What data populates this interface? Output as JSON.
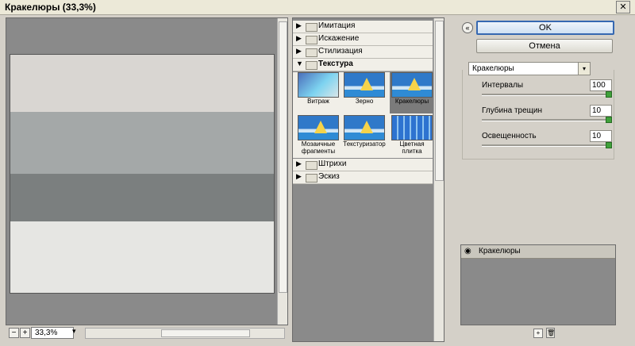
{
  "window": {
    "title": "Кракелюры (33,3%)",
    "close_glyph": "✕"
  },
  "preview": {
    "zoom_out_glyph": "−",
    "zoom_in_glyph": "+",
    "zoom_value": "33,3%",
    "dropdown_glyph": "▾"
  },
  "gallery": {
    "folders": [
      {
        "label": "Имитация",
        "open": false,
        "tri": "▶"
      },
      {
        "label": "Искажение",
        "open": false,
        "tri": "▶"
      },
      {
        "label": "Стилизация",
        "open": false,
        "tri": "▶"
      },
      {
        "label": "Текстура",
        "open": true,
        "tri": "▼"
      },
      {
        "label": "Штрихи",
        "open": false,
        "tri": "▶"
      },
      {
        "label": "Эскиз",
        "open": false,
        "tri": "▶"
      }
    ],
    "thumbs": [
      {
        "label": "Витраж",
        "selected": false
      },
      {
        "label": "Зерно",
        "selected": false
      },
      {
        "label": "Кракелюры",
        "selected": true
      },
      {
        "label": "Мозаичные фрагменты",
        "selected": false
      },
      {
        "label": "Текстуризатор",
        "selected": false
      },
      {
        "label": "Цветная плитка",
        "selected": false
      }
    ]
  },
  "controls": {
    "collapse_glyph": "«",
    "ok_label": "OK",
    "cancel_label": "Отмена",
    "filter_selected": "Кракелюры",
    "filter_arrow": "▾",
    "params": [
      {
        "label": "Интервалы",
        "value": "100"
      },
      {
        "label": "Глубина трещин",
        "value": "10"
      },
      {
        "label": "Освещенность",
        "value": "10"
      }
    ]
  },
  "layers": {
    "eye_glyph": "◉",
    "items": [
      {
        "name": "Кракелюры"
      }
    ],
    "new_layer_glyph": "+",
    "delete_glyph": "🗑"
  }
}
